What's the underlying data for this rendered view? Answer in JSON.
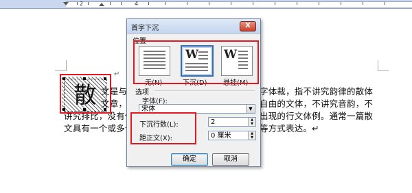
{
  "ruler": {
    "marks": [
      "2",
      "4"
    ]
  },
  "document": {
    "big_char": "散",
    "lines": [
      "文是与",
      "字体裁，指不讲究韵律的散体",
      "文章，",
      "自由的文体，不讲究音韵，不",
      "讲究排比，没有任",
      "出现的行文体例。通常一篇散",
      "文具有一个或多个",
      "等方式表达。↵"
    ],
    "return_mark": "↵"
  },
  "dialog": {
    "title": "首字下沉",
    "close_symbol": "X",
    "position_label": "位置",
    "options": [
      {
        "label": "无(N)",
        "letter": ""
      },
      {
        "label": "下沉(D)",
        "letter": "W"
      },
      {
        "label": "悬挂(M)",
        "letter": "W"
      }
    ],
    "options_label": "选项",
    "font_label": "字体(F):",
    "font_value": "宋体",
    "lines_label": "下沉行数(L):",
    "lines_value": "2",
    "distance_label": "距正文(X):",
    "distance_value": "0 厘米",
    "ok_label": "确定",
    "cancel_label": "取消"
  }
}
